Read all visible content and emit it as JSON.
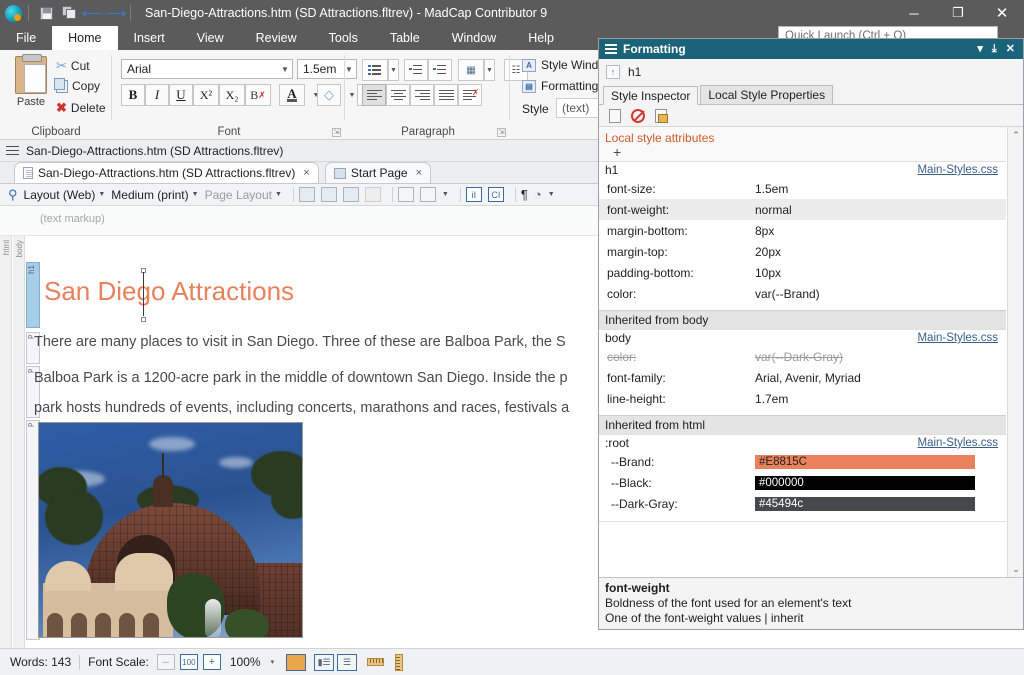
{
  "titlebar": {
    "document_title": "San-Diego-Attractions.htm (SD Attractions.fltrev) - MadCap Contributor 9",
    "quick_access": [
      {
        "name": "save",
        "label": "Save"
      },
      {
        "name": "save-all",
        "label": "Save All"
      },
      {
        "name": "undo",
        "label": "Undo",
        "glyph": "←"
      },
      {
        "name": "redo",
        "label": "Redo",
        "glyph": "→"
      }
    ],
    "window_controls": {
      "minimize": "─",
      "maximize": "❐",
      "close": "✕"
    }
  },
  "ribbon_tabs": [
    {
      "label": "File",
      "active": false
    },
    {
      "label": "Home",
      "active": true
    },
    {
      "label": "Insert",
      "active": false
    },
    {
      "label": "View",
      "active": false
    },
    {
      "label": "Review",
      "active": false
    },
    {
      "label": "Tools",
      "active": false
    },
    {
      "label": "Table",
      "active": false
    },
    {
      "label": "Window",
      "active": false
    },
    {
      "label": "Help",
      "active": false
    }
  ],
  "quick_launch": {
    "placeholder": "Quick Launch (Ctrl + Q)",
    "value": ""
  },
  "ribbon": {
    "clipboard": {
      "group_label": "Clipboard",
      "paste_label": "Paste",
      "cut_label": "Cut",
      "copy_label": "Copy",
      "delete_label": "Delete"
    },
    "font": {
      "group_label": "Font",
      "font_family": "Arial",
      "font_size": "1.5em",
      "bold": "B",
      "italic": "I",
      "underline": "U",
      "superscript": "X²",
      "subscript": "X₂",
      "clear_format": "B",
      "text_color": "A",
      "highlight": "◢"
    },
    "paragraph": {
      "group_label": "Paragraph",
      "bullets": "bullet-list",
      "decrease_indent": "decrease-indent",
      "increase_indent": "increase-indent",
      "image_options": "image-options",
      "borders": "borders",
      "align_left": "align-left",
      "align_center": "align-center",
      "align_right": "align-right",
      "align_justify": "align-justify",
      "clear_paragraph": "clear-paragraph"
    },
    "styles": {
      "style_window_label": "Style Window",
      "formatting_label": "Formatting",
      "style_label": "Style",
      "style_value": "(text)"
    }
  },
  "doc_pane": {
    "header_title": "San-Diego-Attractions.htm (SD Attractions.fltrev)",
    "tabs": [
      {
        "label": "San-Diego-Attractions.htm (SD Attractions.fltrev)",
        "active": true,
        "close": "×"
      },
      {
        "label": "Start Page",
        "active": false,
        "close": "×"
      }
    ],
    "toolbar": {
      "layout": "Layout (Web)",
      "medium": "Medium (print)",
      "page_layout": "Page Layout",
      "caret": "▾",
      "pilcrow": "¶",
      "index_entry": "iI",
      "concept": "CI"
    },
    "markup_text": "(text markup)"
  },
  "document": {
    "structure_bars": [
      "html",
      "body"
    ],
    "tags": [
      "h1",
      "p",
      "p",
      "p"
    ],
    "heading": "San Diego Attractions",
    "paragraphs": [
      "There are many places to visit in San Diego. Three of these are Balboa Park, the S",
      "Balboa Park is a 1200-acre park in the middle of downtown San Diego. Inside the p",
      "park hosts hundreds of events, including concerts, marathons and races, festivals a"
    ],
    "image_alt": "Botanical Building at Balboa Park"
  },
  "statusbar": {
    "words_label": "Words: 143",
    "font_scale_label": "Font Scale:",
    "zoom_out": "─",
    "zoom_reset": "100",
    "zoom_in": "+",
    "zoom_value": "100%",
    "zoom_caret": "▾",
    "view_buttons": [
      {
        "name": "web-layout-button",
        "active": true
      },
      {
        "name": "print-layout-button",
        "active": true
      },
      {
        "name": "split-layout-button",
        "active": true
      }
    ],
    "ruler_buttons": [
      {
        "name": "horizontal-ruler-button"
      },
      {
        "name": "vertical-ruler-button"
      }
    ]
  },
  "formatting_panel": {
    "title": "Formatting",
    "header_buttons": {
      "menu": "▾",
      "pin": "⤓",
      "close": "✕"
    },
    "selector": "h1",
    "tabs": [
      {
        "label": "Style Inspector",
        "active": true
      },
      {
        "label": "Local Style Properties",
        "active": false
      }
    ],
    "toolbar_icons": [
      "page-icon",
      "no-styles-icon",
      "edit-style-icon"
    ],
    "local_attributes": {
      "title": "Local style attributes",
      "add": "+"
    },
    "rules": [
      {
        "selector": "h1",
        "source": "Main-Styles.css",
        "properties": [
          {
            "name": "font-size:",
            "value": "1.5em",
            "struck": false,
            "highlighted": false
          },
          {
            "name": "font-weight:",
            "value": "normal",
            "struck": false,
            "highlighted": true
          },
          {
            "name": "margin-bottom:",
            "value": "8px",
            "struck": false,
            "highlighted": false
          },
          {
            "name": "margin-top:",
            "value": "20px",
            "struck": false,
            "highlighted": false
          },
          {
            "name": "padding-bottom:",
            "value": "10px",
            "struck": false,
            "highlighted": false
          },
          {
            "name": "color:",
            "value": "var(--Brand)",
            "struck": false,
            "highlighted": false
          }
        ]
      }
    ],
    "inherited_body": {
      "header": "Inherited from body",
      "selector": "body",
      "source": "Main-Styles.css",
      "properties": [
        {
          "name": "color:",
          "value": "var(--Dark-Gray)",
          "struck": true
        },
        {
          "name": "font-family:",
          "value": "Arial, Avenir, Myriad",
          "struck": false
        },
        {
          "name": "line-height:",
          "value": "1.7em",
          "struck": false
        }
      ]
    },
    "inherited_html": {
      "header": "Inherited from html",
      "selector": ":root",
      "source": "Main-Styles.css",
      "variables": [
        {
          "name": "--Brand:",
          "value": "#E8815C",
          "swatch": "#E8815C",
          "text_color": "#1f1f1f"
        },
        {
          "name": "--Black:",
          "value": "#000000",
          "swatch": "#000000",
          "text_color": "#ffffff"
        },
        {
          "name": "--Dark-Gray:",
          "value": "#45494c",
          "swatch": "#45494c",
          "text_color": "#ffffff"
        }
      ]
    },
    "description": {
      "name": "font-weight",
      "line1": "Boldness of the font used for an element's text",
      "line2": "One of the font-weight values | inherit"
    },
    "scrollbar": {
      "up": "⌃",
      "down": "⌄"
    }
  },
  "colors": {
    "brand": "#E8815C",
    "panel_header": "#1a6379",
    "titlebar": "#5b5b5b",
    "accent_blue": "#3a6da8"
  }
}
